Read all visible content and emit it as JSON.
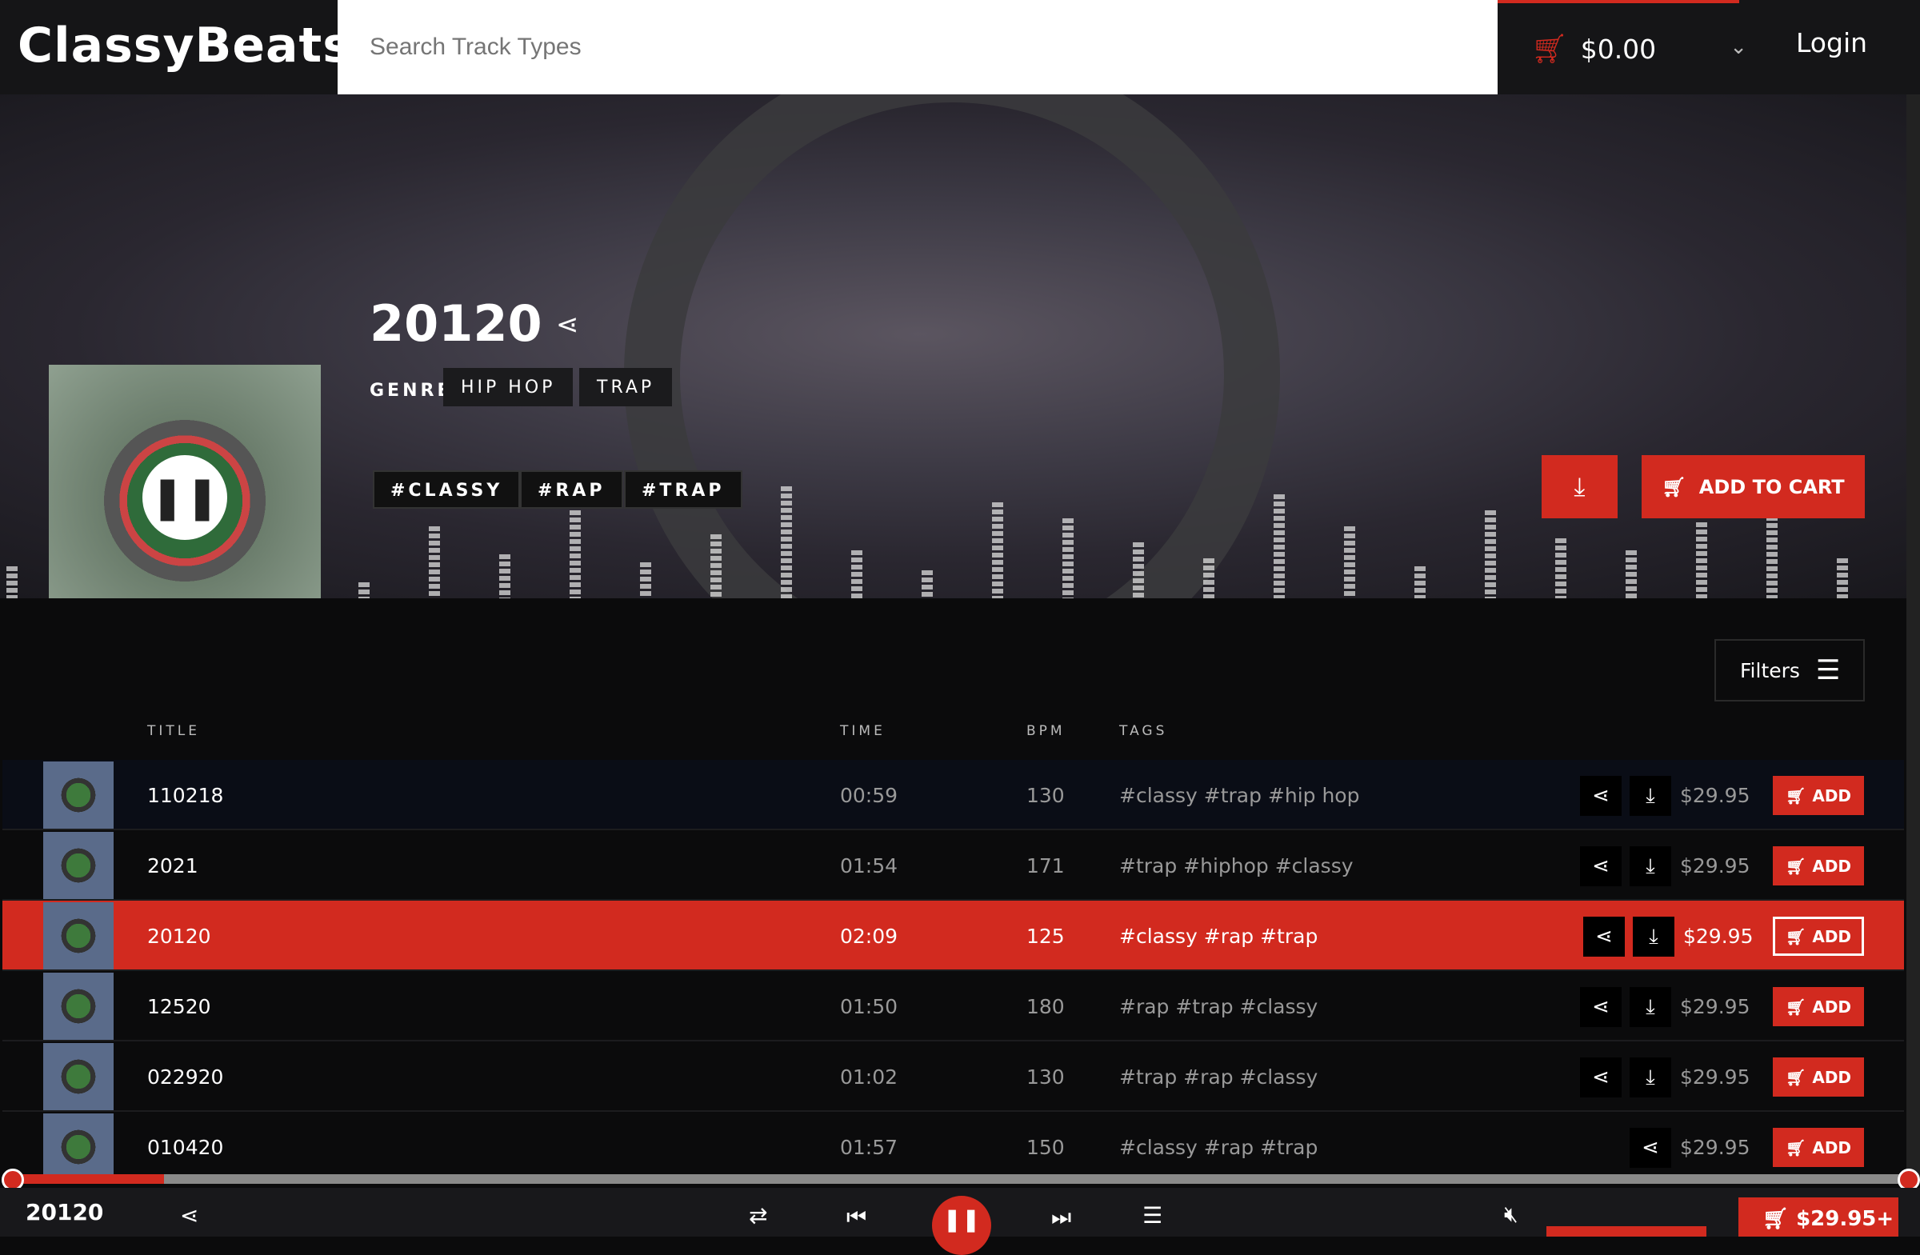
{
  "header": {
    "logo": "ClassyBeats",
    "search_placeholder": "Search Track Types",
    "cart_total": "$0.00",
    "login": "Login"
  },
  "hero": {
    "title": "20120",
    "genre_label": "GENRE",
    "genres": [
      "HIP HOP",
      "TRAP"
    ],
    "tags": [
      "#CLASSY",
      "#RAP",
      "#TRAP"
    ],
    "add_to_cart": "ADD TO CART"
  },
  "list": {
    "filters": "Filters",
    "columns": {
      "title": "TITLE",
      "time": "TIME",
      "bpm": "BPM",
      "tags": "TAGS"
    },
    "rows": [
      {
        "title": "110218",
        "time": "00:59",
        "bpm": "130",
        "tags": "#classy #trap #hip hop",
        "price": "$29.95",
        "add": "ADD"
      },
      {
        "title": "2021",
        "time": "01:54",
        "bpm": "171",
        "tags": "#trap #hiphop #classy",
        "price": "$29.95",
        "add": "ADD"
      },
      {
        "title": "20120",
        "time": "02:09",
        "bpm": "125",
        "tags": "#classy #rap #trap",
        "price": "$29.95",
        "add": "ADD"
      },
      {
        "title": "12520",
        "time": "01:50",
        "bpm": "180",
        "tags": "#rap #trap #classy",
        "price": "$29.95",
        "add": "ADD"
      },
      {
        "title": "022920",
        "time": "01:02",
        "bpm": "130",
        "tags": "#trap #rap #classy",
        "price": "$29.95",
        "add": "ADD"
      },
      {
        "title": "010420",
        "time": "01:57",
        "bpm": "150",
        "tags": "#classy #rap #trap",
        "price": "$29.95",
        "add": "ADD"
      }
    ]
  },
  "player": {
    "title": "20120",
    "progress_percent": 8,
    "buy": "$29.95+"
  },
  "colors": {
    "accent": "#d22a1f"
  }
}
